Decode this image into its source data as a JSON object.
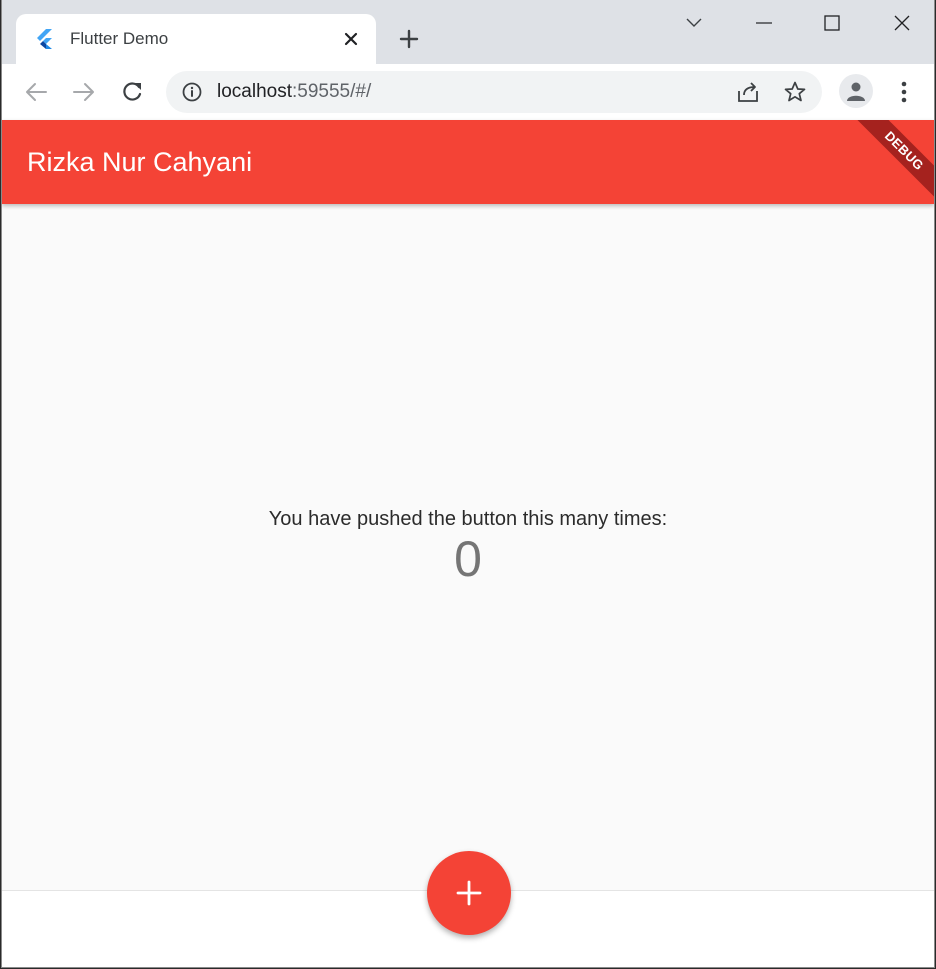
{
  "browser": {
    "tab": {
      "title": "Flutter Demo",
      "favicon": "flutter-logo-icon"
    },
    "address": {
      "host": "localhost",
      "rest": ":59555/#/"
    }
  },
  "app": {
    "appbar_title": "Rizka Nur Cahyani",
    "debug_label": "DEBUG",
    "counter_text": "You have pushed the button this many times:",
    "counter_value": "0"
  },
  "colors": {
    "primary": "#f44336",
    "debug": "#a5221e",
    "background": "#fafafa"
  }
}
